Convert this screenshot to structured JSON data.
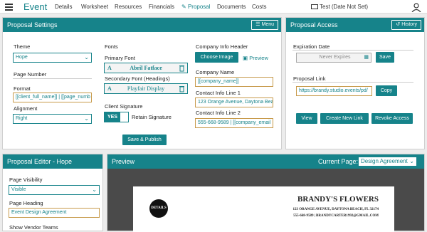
{
  "nav": {
    "brand": "Event",
    "links": [
      "Details",
      "Worksheet",
      "Resources",
      "Financials",
      "Proposal",
      "Documents",
      "Costs"
    ],
    "test_label": "Test (Date Not Set)"
  },
  "settings": {
    "title": "Proposal Settings",
    "menu_btn": "Menu",
    "theme_label": "Theme",
    "theme_value": "Hope",
    "page_number_label": "Page Number",
    "format_label": "Format",
    "format_value": "[[client_full_name]] | [[page_numb",
    "alignment_label": "Alignment",
    "alignment_value": "Right",
    "fonts_label": "Fonts",
    "primary_font_label": "Primary Font",
    "primary_font": "Abril Fatface",
    "secondary_font_label": "Secondary Font (Headings)",
    "secondary_font": "Playfair Display",
    "client_sig_label": "Client Signature",
    "toggle_yes": "YES",
    "retain_sig": "Retain Signature",
    "save_publish": "Save & Publish",
    "company_header_label": "Company Info Header",
    "choose_image": "Choose Image",
    "preview_link": "Preview",
    "company_name_label": "Company Name",
    "company_name": "[[company_name]]",
    "contact1_label": "Contact Info Line 1",
    "contact1": "123 Orange Avenue, Daytona Bea",
    "contact2_label": "Contact Info Line 2",
    "contact2": "555-668-9589 | [[company_email"
  },
  "access": {
    "title": "Proposal Access",
    "history_btn": "History",
    "expiration_label": "Expiration Date",
    "expiration_value": "Never Expires",
    "save_btn": "Save",
    "link_label": "Proposal Link",
    "link_value": "https://brandy.studio.events/pd/",
    "copy_btn": "Copy",
    "view_btn": "View",
    "new_link_btn": "Create New Link",
    "revoke_btn": "Revoke Access"
  },
  "editor": {
    "title": "Proposal Editor - Hope",
    "visibility_label": "Page Visibility",
    "visibility_value": "Visible",
    "heading_label": "Page Heading",
    "heading_value": "Event Design Agreement",
    "vendor_label": "Show Vendor Teams"
  },
  "preview": {
    "title": "Preview",
    "current_page_label": "Current Page:",
    "current_page": "Design Agreement",
    "company": "BRANDY'S FLOWERS",
    "address": "123 ORANGE AVENUE, DAYTONA BEACH, FL 32174",
    "contact": "555-668-9589 | BRANDYCARTER1992@GMAIL.COM",
    "logo_text": "DETAILS"
  }
}
